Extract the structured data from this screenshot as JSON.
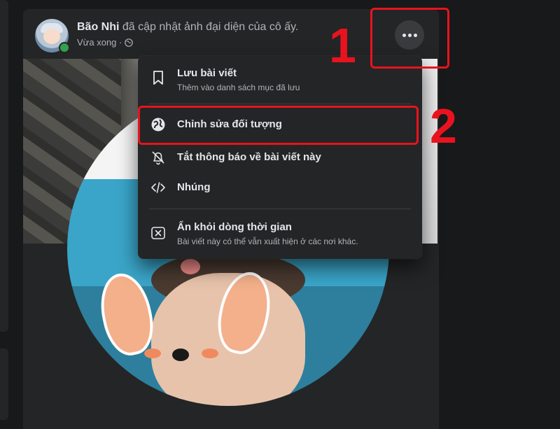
{
  "post": {
    "author": "Bão Nhi",
    "action": "đã cập nhật ảnh đại diện của cô ấy.",
    "time": "Vừa xong ·",
    "privacy_icon": "globe-icon"
  },
  "more_button": {
    "icon": "more-dots-icon"
  },
  "menu": {
    "save": {
      "label": "Lưu bài viết",
      "sublabel": "Thêm vào danh sách mục đã lưu",
      "icon": "bookmark-icon"
    },
    "edit_audience": {
      "label": "Chỉnh sửa đối tượng",
      "icon": "globe-icon"
    },
    "turn_off_notifications": {
      "label": "Tắt thông báo về bài viết này",
      "icon": "bell-off-icon"
    },
    "embed": {
      "label": "Nhúng",
      "icon": "code-icon"
    },
    "hide_from_timeline": {
      "label": "Ẩn khỏi dòng thời gian",
      "sublabel": "Bài viết này có thể vẫn xuất hiện ở các nơi khác.",
      "icon": "close-box-icon"
    }
  },
  "annotations": {
    "step1": "1",
    "step2": "2",
    "color": "#e8131e"
  },
  "colors": {
    "background": "#18191a",
    "card": "#242526",
    "text_primary": "#e4e6eb",
    "text_secondary": "#b0b3b8",
    "online": "#31a24c"
  }
}
